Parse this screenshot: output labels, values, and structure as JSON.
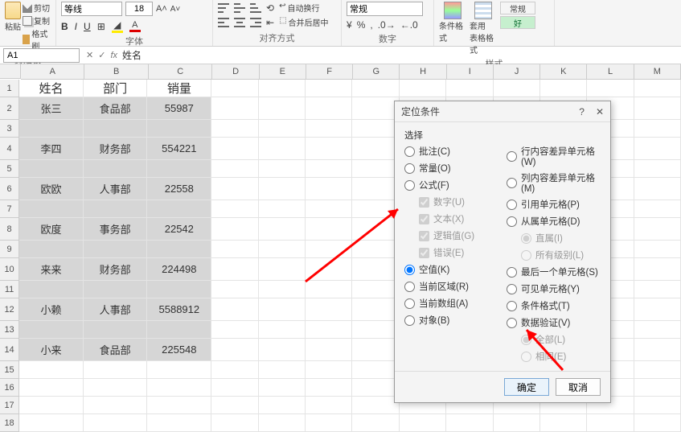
{
  "ribbon": {
    "clipboard": {
      "paste": "粘贴",
      "cut": "剪切",
      "copy": "复制",
      "painter": "格式刷",
      "label": "剪贴板"
    },
    "font": {
      "name": "等线",
      "size": "18",
      "bold": "B",
      "italic": "I",
      "underline": "U",
      "label": "字体"
    },
    "align": {
      "wrap": "自动换行",
      "merge": "合并后居中",
      "label": "对齐方式"
    },
    "number": {
      "format": "常规",
      "label": "数字"
    },
    "styles": {
      "cond": "条件格式",
      "tablefmt": "套用\n表格格式",
      "normal": "常规",
      "good": "好",
      "label": "样式"
    }
  },
  "namebox": {
    "ref": "A1",
    "fx": "fx",
    "value": "姓名"
  },
  "columns": [
    "A",
    "B",
    "C",
    "D",
    "E",
    "F",
    "G",
    "H",
    "I",
    "J",
    "K",
    "L",
    "M"
  ],
  "rowNums": [
    "1",
    "2",
    "3",
    "4",
    "5",
    "6",
    "7",
    "8",
    "9",
    "10",
    "11",
    "12",
    "13",
    "14",
    "15",
    "16",
    "17",
    "18"
  ],
  "table": {
    "header": [
      "姓名",
      "部门",
      "销量"
    ],
    "rows": [
      [
        "张三",
        "食品部",
        "55987"
      ],
      [
        "",
        "",
        ""
      ],
      [
        "李四",
        "财务部",
        "554221"
      ],
      [
        "",
        "",
        ""
      ],
      [
        "欧欧",
        "人事部",
        "22558"
      ],
      [
        "",
        "",
        ""
      ],
      [
        "欧度",
        "事务部",
        "22542"
      ],
      [
        "",
        "",
        ""
      ],
      [
        "来来",
        "财务部",
        "224498"
      ],
      [
        "",
        "",
        ""
      ],
      [
        "小赖",
        "人事部",
        "5588912"
      ],
      [
        "",
        "",
        ""
      ],
      [
        "小来",
        "食品部",
        "225548"
      ]
    ]
  },
  "dialog": {
    "title": "定位条件",
    "help": "?",
    "close": "✕",
    "select": "选择",
    "left": {
      "comment": "批注(C)",
      "constant": "常量(O)",
      "formula": "公式(F)",
      "number": "数字(U)",
      "text": "文本(X)",
      "logic": "逻辑值(G)",
      "error": "错误(E)",
      "blank": "空值(K)",
      "region": "当前区域(R)",
      "array": "当前数组(A)",
      "object": "对象(B)"
    },
    "right": {
      "rowdiff": "行内容差异单元格(W)",
      "coldiff": "列内容差异单元格(M)",
      "precedent": "引用单元格(P)",
      "dependent": "从属单元格(D)",
      "direct": "直属(I)",
      "alllevel": "所有级别(L)",
      "lastcell": "最后一个单元格(S)",
      "visible": "可见单元格(Y)",
      "condfmt": "条件格式(T)",
      "datavalid": "数据验证(V)",
      "all": "全部(L)",
      "same": "相同(E)"
    },
    "ok": "确定",
    "cancel": "取消"
  }
}
